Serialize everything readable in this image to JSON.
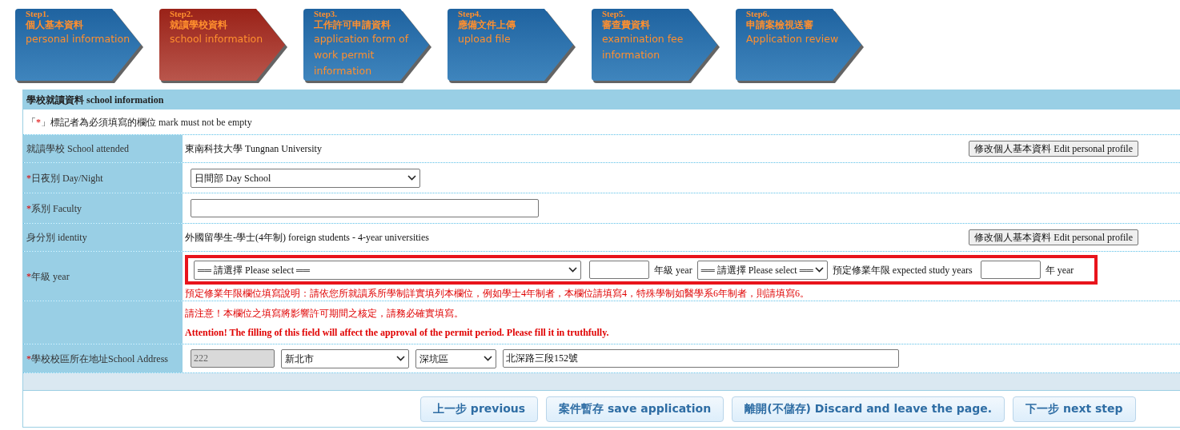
{
  "steps": [
    {
      "step": "Step1.",
      "zh": "個人基本資料",
      "en": "personal information",
      "selected": false
    },
    {
      "step": "Step2.",
      "zh": "就讀學校資料",
      "en": "school information",
      "selected": true
    },
    {
      "step": "Step3.",
      "zh": "工作許可申請資料",
      "en": "application form of work permit information",
      "selected": false
    },
    {
      "step": "Step4.",
      "zh": "應備文件上傳",
      "en": "upload file",
      "selected": false
    },
    {
      "step": "Step5.",
      "zh": "審查費資料",
      "en": "examination fee information",
      "selected": false
    },
    {
      "step": "Step6.",
      "zh": "申請案檢視送審",
      "en": "Application review",
      "selected": false
    }
  ],
  "form": {
    "title": "學校就讀資料 school information",
    "note": {
      "open": "「",
      "mark": "*",
      "rest": "」標記者為必須填寫的欄位 mark must not be empty"
    },
    "rows": [
      {
        "kind": "text",
        "label": "就讀學校 School attended",
        "value": "東南科技大學 Tungnan University",
        "button": "修改個人基本資料 Edit personal profile"
      },
      {
        "kind": "select",
        "mark": "*",
        "label": "日夜別 Day/Night",
        "value": "日間部 Day School"
      },
      {
        "kind": "input",
        "mark": "*",
        "label": "系別 Faculty"
      },
      {
        "kind": "text",
        "label": "身分別 identity",
        "value": "外國留學生-學士(4年制) foreign students - 4-year universities",
        "button": "修改個人基本資料 Edit personal profile"
      },
      {
        "kind": "year",
        "mark": "*",
        "label": "年級 year",
        "highlighted": true,
        "items": [
          {
            "kind": "select",
            "value": "══ 請選擇 Please select ══"
          },
          {
            "kind": "input"
          },
          {
            "kind": "text",
            "value": "年級 year"
          },
          {
            "kind": "select",
            "value": "══ 請選擇 Please select ══"
          },
          {
            "kind": "text",
            "value": "預定修業年限 expected study years"
          },
          {
            "kind": "input"
          },
          {
            "kind": "text",
            "value": "年 year"
          }
        ],
        "hint": "預定修業年限欄位填寫說明：請依您所就讀系所學制詳實填列本欄位，例如學士4年制者，本欄位請填寫4，特殊學制如醫學系6年制者，則請填寫6。"
      },
      {
        "kind": "notice",
        "lines": [
          "請注意！本欄位之填寫將影響許可期間之核定，請務必確實填寫。",
          "Attention! The filling of this field will affect the approval of the permit period. Please fill it in truthfully."
        ]
      },
      {
        "kind": "address",
        "mark": "*",
        "label": "學校校區所在地址School Address",
        "zip": "222",
        "city": "新北市",
        "district": "深坑區",
        "street": "北深路三段152號"
      }
    ]
  },
  "buttons": [
    "上一步 previous",
    "案件暫存 save application",
    "離開(不儲存) Discard and leave the page.",
    "下一步 next step"
  ]
}
